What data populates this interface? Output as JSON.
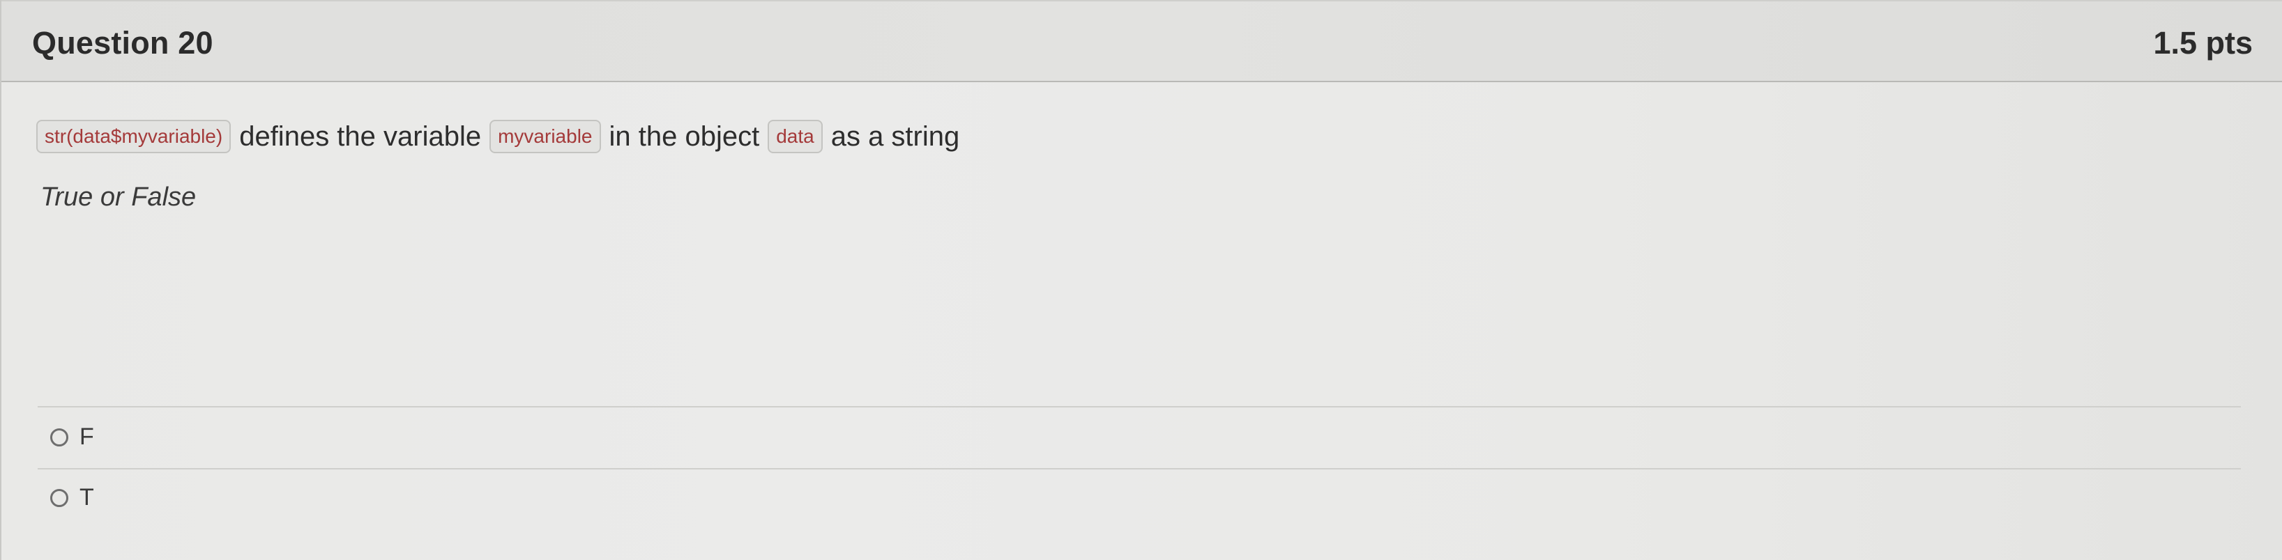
{
  "question": {
    "title": "Question 20",
    "points": "1.5 pts"
  },
  "stem": {
    "code_1": "str(data$myvariable)",
    "text_1": "defines the variable",
    "code_2": "myvariable",
    "text_2": "in the object",
    "code_3": "data",
    "text_3": "as a string"
  },
  "instruction": "True or False",
  "answers": [
    {
      "label": "F"
    },
    {
      "label": "T"
    }
  ]
}
